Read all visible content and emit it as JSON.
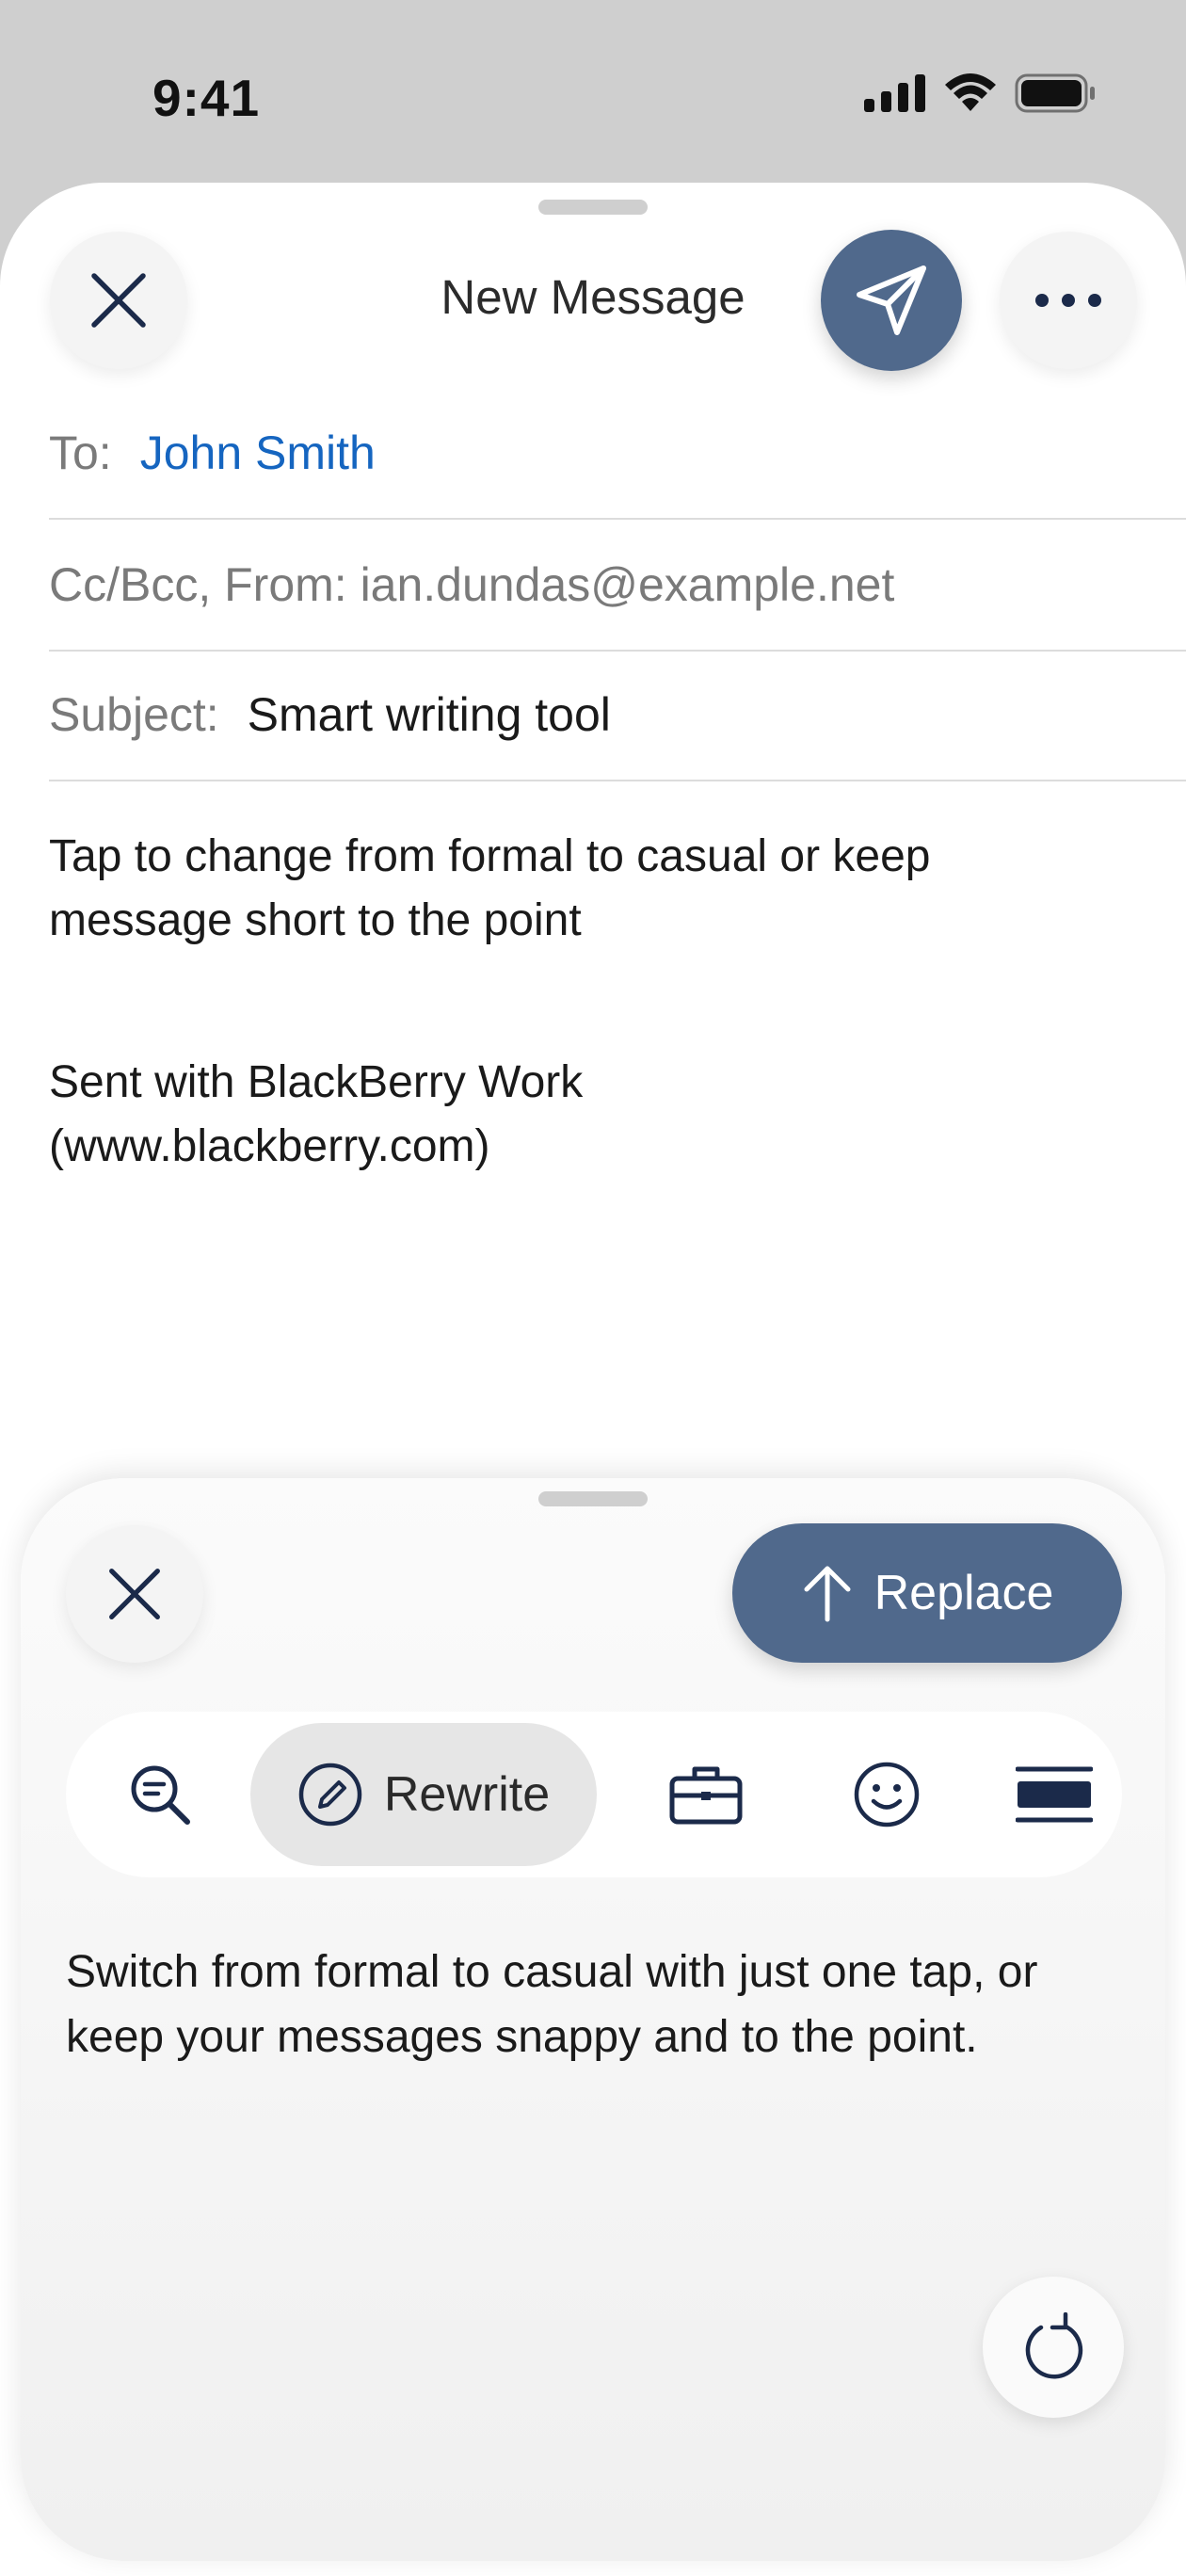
{
  "status_bar": {
    "time": "9:41",
    "icons": [
      "cellular-signal-icon",
      "wifi-icon",
      "battery-icon"
    ]
  },
  "compose": {
    "title": "New Message",
    "buttons": [
      "close-icon",
      "send-icon",
      "more-icon"
    ],
    "to_label": "To:",
    "to_value": "John Smith",
    "cc_text": "Cc/Bcc, From: ian.dundas@example.net",
    "subject_label": "Subject:",
    "subject_value": "Smart writing tool",
    "body_line1": "Tap to change from formal to casual or keep",
    "body_line2": "message short to the point",
    "signature_line1": "Sent with BlackBerry Work",
    "signature_line2": "(www.blackberry.com)"
  },
  "writing_tool": {
    "replace_label": "Replace",
    "active_tool_label": "Rewrite",
    "tools": [
      "proofread-icon",
      "rewrite-icon",
      "professional-icon",
      "friendly-icon",
      "concise-icon"
    ],
    "suggestion": "Switch from formal to casual with just one tap, or keep your messages snappy and to the point."
  },
  "colors": {
    "accent": "#50698c",
    "link": "#1565c0",
    "icon_dark": "#1b2a4a"
  }
}
